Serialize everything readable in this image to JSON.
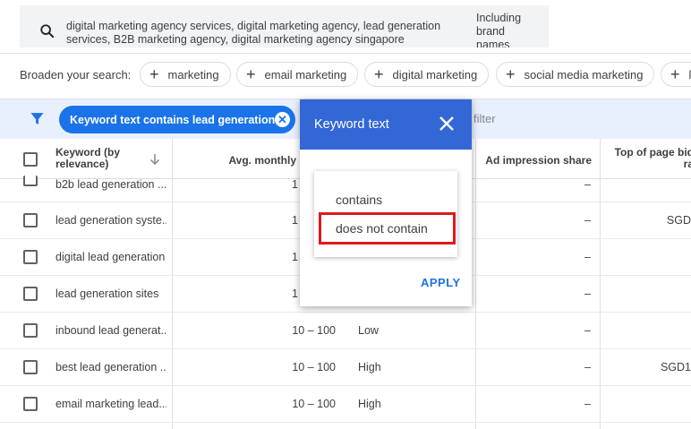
{
  "search": {
    "query": "digital marketing agency services, digital marketing agency, lead generation services, B2B marketing agency, digital marketing agency singapore",
    "including_brand_names": "Including brand names"
  },
  "broaden": {
    "label": "Broaden your search:",
    "chips": [
      "marketing",
      "email marketing",
      "digital marketing",
      "social media marketing",
      "le"
    ]
  },
  "filter": {
    "chip_label": "Keyword text contains lead generation",
    "add_filter_label": "filter"
  },
  "table": {
    "headers": {
      "keyword": "Keyword (by relevance)",
      "avg_monthly": "Avg. monthly",
      "ad_impression_share": "Ad impression share",
      "top_of_page_bid": "Top of page bid ra"
    },
    "rows": [
      {
        "keyword": "b2b lead generation ...",
        "volume": "1",
        "competition": "",
        "impression": "–",
        "bid": ""
      },
      {
        "keyword": "lead generation syste...",
        "volume": "1",
        "competition": "",
        "impression": "–",
        "bid": "SGD"
      },
      {
        "keyword": "digital lead generation",
        "volume": "1",
        "competition": "",
        "impression": "–",
        "bid": ""
      },
      {
        "keyword": "lead generation sites",
        "volume": "1",
        "competition": "",
        "impression": "–",
        "bid": ""
      },
      {
        "keyword": "inbound lead generat...",
        "volume": "10 – 100",
        "competition": "Low",
        "impression": "–",
        "bid": ""
      },
      {
        "keyword": "best lead generation ...",
        "volume": "10 – 100",
        "competition": "High",
        "impression": "–",
        "bid": "SGD1"
      },
      {
        "keyword": "email marketing lead...",
        "volume": "10 – 100",
        "competition": "High",
        "impression": "–",
        "bid": ""
      }
    ]
  },
  "popup": {
    "title": "Keyword text",
    "options": [
      "contains",
      "does not contain"
    ],
    "apply_label": "APPLY",
    "highlight_color": "#e0191e",
    "header_color": "#3367d6"
  }
}
